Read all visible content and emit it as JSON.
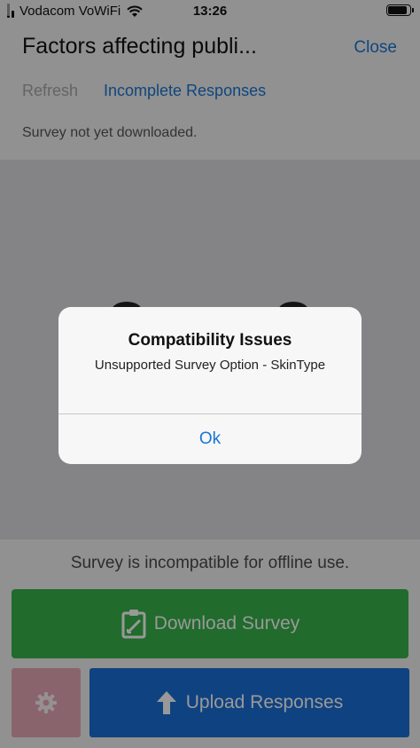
{
  "status_bar": {
    "carrier": "Vodacom VoWiFi",
    "time": "13:26",
    "signal_bars_active": 2,
    "signal_bars_total": 4,
    "battery_level": 0.8
  },
  "header": {
    "title": "Factors affecting publi...",
    "close_label": "Close"
  },
  "actions": {
    "refresh_label": "Refresh",
    "incomplete_label": "Incomplete Responses"
  },
  "survey_status": "Survey not yet downloaded.",
  "footer": {
    "incompatible_text": "Survey is incompatible for offline use.",
    "download_label": "Download Survey",
    "upload_label": "Upload Responses"
  },
  "alert": {
    "title": "Compatibility Issues",
    "message": "Unsupported Survey Option - SkinType",
    "ok_label": "Ok"
  },
  "colors": {
    "link": "#1a75d2",
    "download": "#38b24a",
    "upload": "#1a6fd8",
    "settings": "#e6a7b5"
  },
  "icons": {
    "download": "clipboard-check-icon",
    "settings": "gear-icon",
    "upload": "arrow-up-icon"
  }
}
